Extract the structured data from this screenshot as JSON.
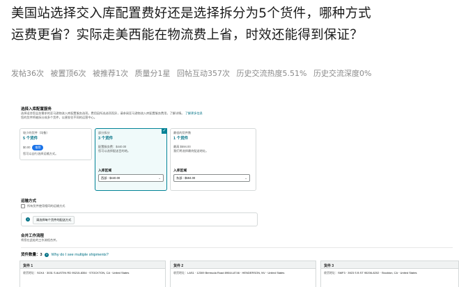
{
  "question": {
    "title": "美国站选择交入库配置费好还是选择拆分为5个货件，哪种方式运费更省？实际走美西能在物流费上省，时效还能得到保证？"
  },
  "stats": [
    "发帖36次",
    "被置顶6次",
    "被推荐1次",
    "质量分1星",
    "回帖互动357次",
    "历史交流热度5.51%",
    "历史交流深度0%"
  ],
  "screenshot": {
    "inbound_title": "选择入库配置服务",
    "inbound_desc_1": "选择适合您业务需求的亚马逊物流入库配置服务选项。费用因所选选项而异，请参阅亚马逊物流入库配置服务费用，了解详情。",
    "inbound_desc_2": "您的货件将被拆分成多个货件，以便发往不同的运营中心。",
    "learn_more": "了解更多信息",
    "options": [
      {
        "top": "较少的货件（均衡）",
        "main": "5 个货件",
        "fee_label": "$0.00",
        "badge": "推荐",
        "desc": "您可以自行选择运输方式。"
      },
      {
        "top": "部分拆分",
        "main": "3 个货件",
        "fee_label": "配置服务费：$440.00",
        "desc": "您可以选择配送目的地。",
        "region_label": "入库区域",
        "region_value": "西部 - $440.00"
      },
      {
        "top": "最低的货件数",
        "main": "1 个货件",
        "fee_label": "最高 $594.00",
        "desc": "我们将选择最终配送地址。",
        "region_label": "入库区域",
        "region_value": "东部 - $594.00"
      }
    ],
    "ship_method_title": "运输方式",
    "ship_method_check": "所有货件使用相同的运输方式",
    "info_text": "请选择每个货件的配送方式",
    "combine_title": "合并工作流程",
    "combine_desc": "将您在此处的工作流程合并。",
    "count_label": "货件数量：3",
    "count_link": "Why do I see multiple shipments?",
    "shipments": [
      {
        "name": "货件 1",
        "addr_label": "收货地址：",
        "addr": "SCK4 · 3031 S AUSTIN RD 95215-8354 · STOCKTON, CA · United States"
      },
      {
        "name": "货件 2",
        "addr_label": "收货地址：",
        "addr": "LAS1 · 12309 Bermuda Road 89044-8746 · HENDERSON, NV · United States"
      },
      {
        "name": "货件 3",
        "addr_label": "收货地址：",
        "addr": "SMF3 · 3923 S B ST 95206-8202 · Stockton, CA · United States"
      }
    ]
  },
  "colors": {
    "selected_border": "#008296",
    "link": "#007185",
    "badge": "#1b73e8"
  }
}
